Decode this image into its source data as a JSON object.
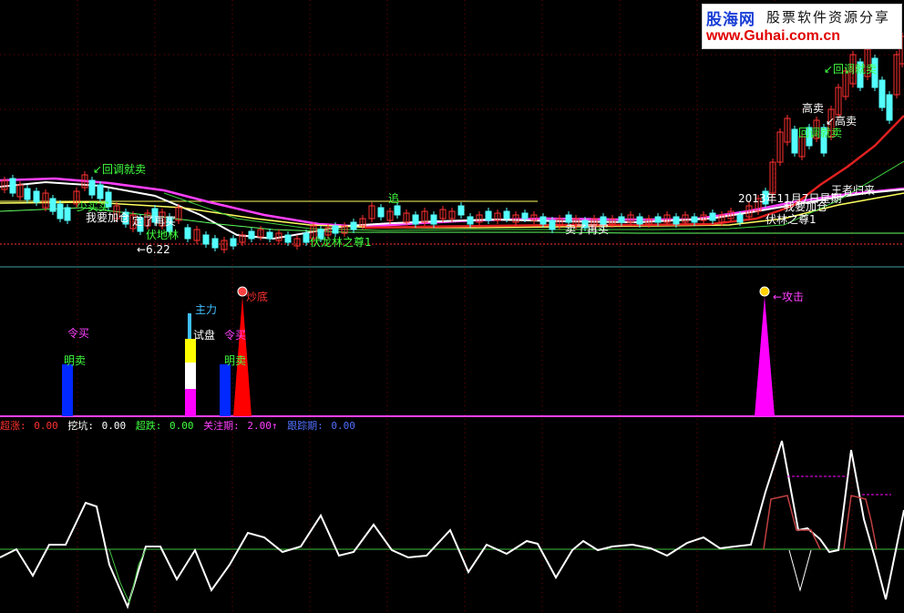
{
  "watermark": {
    "brand": "股海网",
    "tagline": "股票软件资源分享",
    "url": "www.Guhai.com.cn"
  },
  "colors": {
    "background": "#000000",
    "grid": "#7a0000",
    "bull_candle": "#ff3030",
    "bear_candle": "#54ffff",
    "ma_purple": "#ff40ff",
    "ma_white": "#ffffff",
    "ma_yellow": "#ffff60",
    "ma_red": "#e02020",
    "ma_green": "#40d040",
    "note_green": "#40ff40",
    "note_white": "#ffffff",
    "bar_blue": "#0028ff",
    "bar_magenta": "#ff00ff",
    "bar_red": "#ff0000",
    "bar_yellow": "#ffff00",
    "bar_cyan": "#40c0ff"
  },
  "price_panel": {
    "annotations": [
      {
        "text": "↙回调就卖",
        "color": "#40ff40"
      },
      {
        "text": "卖了再买",
        "color": "#ffffff"
      },
      {
        "text": "我要加仓",
        "color": "#ffffff"
      },
      {
        "text": "定了再买",
        "color": "#ffffff"
      },
      {
        "text": "少买买",
        "color": "#40ff40"
      },
      {
        "text": "伏地林",
        "color": "#40ff40"
      },
      {
        "text": "伏龙林之尊1",
        "color": "#40ff40"
      },
      {
        "text": "←6.22",
        "color": "#ffffff"
      },
      {
        "text": "追",
        "color": "#40ff40"
      },
      {
        "text": "卖了再买",
        "color": "#ffffff"
      },
      {
        "text": "2013年11月7日星期",
        "color": "#ffffff"
      },
      {
        "text": "王者归来",
        "color": "#ffffff"
      },
      {
        "text": "我要加仓",
        "color": "#ffffff"
      },
      {
        "text": "伏林之尊1",
        "color": "#ffffff"
      },
      {
        "text": "高卖",
        "color": "#ffffff"
      },
      {
        "text": "↙高卖",
        "color": "#ffffff"
      },
      {
        "text": "回调就卖",
        "color": "#40ff40"
      },
      {
        "text": "↙回调就卖",
        "color": "#40ff40"
      }
    ]
  },
  "signal_panel": {
    "labels": [
      {
        "text": "令买",
        "color": "#ff40ff"
      },
      {
        "text": "明卖",
        "color": "#40ff40"
      },
      {
        "text": "主力",
        "color": "#40c0ff"
      },
      {
        "text": "试盘",
        "color": "#ffffff"
      },
      {
        "text": "令买",
        "color": "#ff40ff"
      },
      {
        "text": "明卖",
        "color": "#40ff40"
      },
      {
        "text": "炒底",
        "color": "#ff3030"
      },
      {
        "text": "←攻击",
        "color": "#ff40ff"
      }
    ],
    "status": [
      {
        "label": "超涨:",
        "value": "0.00",
        "color": "#ff3030"
      },
      {
        "label": "挖坑:",
        "value": "0.00",
        "color": "#ffffff"
      },
      {
        "label": "超跌:",
        "value": "0.00",
        "color": "#40ff40"
      },
      {
        "label": "关注期:",
        "value": "2.00↑",
        "color": "#ff40ff"
      },
      {
        "label": "跟踪期:",
        "value": "0.00",
        "color": "#5070ff"
      }
    ]
  }
}
